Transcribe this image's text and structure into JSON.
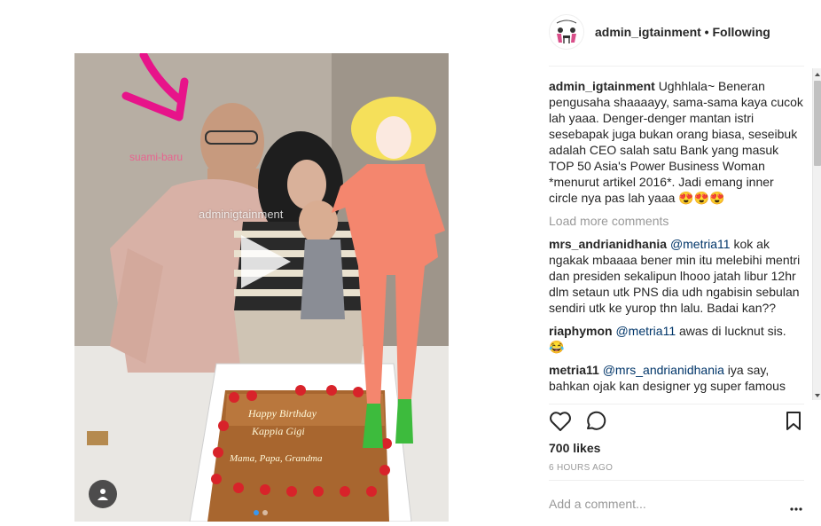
{
  "post": {
    "media": {
      "overlay_husband": "suami-baru",
      "overlay_watermark": "adminigtainment",
      "play_icon": "play-icon",
      "user_tag_icon": "user-icon",
      "carousel_total": 2,
      "carousel_active": 1
    },
    "header": {
      "username": "admin_igtainment",
      "separator": " • ",
      "follow_status": "Following"
    },
    "caption": {
      "username": "admin_igtainment",
      "text": "Ughhlala~ Beneran pengusaha shaaaayy, sama-sama kaya cucok lah yaaa. Denger-denger mantan istri sesebapak juga bukan orang biasa, seseibuk adalah CEO salah satu Bank yang masuk TOP 50 Asia's Power Business Woman *menurut artikel 2016*. Jadi emang inner circle nya pas lah yaaa 😍😍😍"
    },
    "load_more_label": "Load more comments",
    "comments": [
      {
        "username": "mrs_andrianidhania",
        "mention": "@metria11",
        "text": " kok ak ngakak mbaaaa bener min itu melebihi mentri dan presiden sekalipun lhooo jatah libur 12hr dlm setaun utk PNS dia udh ngabisin sebulan sendiri utk ke yurop thn lalu. Badai kan??"
      },
      {
        "username": "riaphymon",
        "mention": "@metria11",
        "text": " awas di lucknut sis. 😂"
      },
      {
        "username": "metria11",
        "mention": "@mrs_andrianidhania",
        "text": " iya say, bahkan ojak kan designer yg super famous"
      }
    ],
    "actions": {
      "like_icon": "heart-icon",
      "comment_icon": "comment-icon",
      "save_icon": "bookmark-icon"
    },
    "likes": "700 likes",
    "timestamp": "6 HOURS AGO",
    "add_comment_placeholder": "Add a comment...",
    "more_options_icon": "more-options-icon"
  },
  "colors": {
    "accent_link": "#003569",
    "muted": "#999999",
    "carousel_active": "#3897f0",
    "annotation_pink": "#e7148a",
    "cartoon_skin": "#f4866e",
    "cartoon_hair": "#f5e05a",
    "cartoon_shoe": "#3dbb3d"
  }
}
